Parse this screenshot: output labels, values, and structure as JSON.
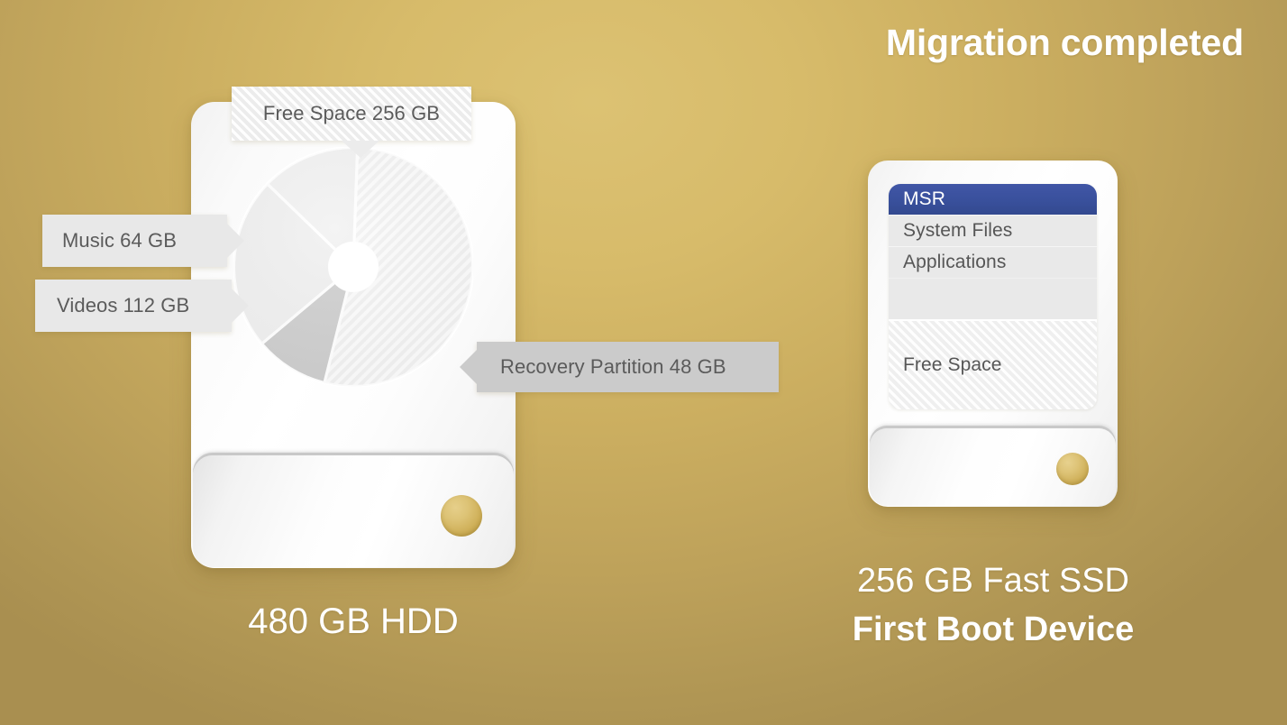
{
  "title": "Migration completed",
  "theme": {
    "background_gold_light": "#DCC273",
    "background_gold_dark": "#A98F50",
    "drive_white": "#FFFFFF",
    "callout_light": "#E8E8E8",
    "callout_dark": "#CBCBCB",
    "msr_blue": "#3B52A0",
    "led_gold": "#DDC376",
    "text_gray": "#5B5B5B",
    "text_white": "#FFFFFF"
  },
  "source_drive": {
    "caption": "480 GB HDD",
    "total_gb": 480,
    "callouts": [
      {
        "label": "Free Space 256 GB",
        "name": "Free Space",
        "size_gb": 256,
        "style": "hatched",
        "tail": "down"
      },
      {
        "label": "Music 64 GB",
        "name": "Music",
        "size_gb": 64,
        "style": "light",
        "tail": "right"
      },
      {
        "label": "Videos 112 GB",
        "name": "Videos",
        "size_gb": 112,
        "style": "light",
        "tail": "right"
      },
      {
        "label": "Recovery Partition 48 GB",
        "name": "Recovery Partition",
        "size_gb": 48,
        "style": "dark",
        "tail": "left"
      }
    ]
  },
  "target_drive": {
    "caption_line1": "256 GB Fast SSD",
    "caption_line2": "First Boot Device",
    "total_gb": 256,
    "partitions": [
      {
        "label": "MSR",
        "style": "msr"
      },
      {
        "label": "System Files",
        "style": "plain"
      },
      {
        "label": "Applications",
        "style": "plain"
      },
      {
        "label": "",
        "style": "empty-gap"
      },
      {
        "label": "Free Space",
        "style": "hatched"
      }
    ]
  },
  "chart_data": {
    "type": "pie",
    "title": "480 GB HDD partition usage",
    "units": "GB",
    "total": 480,
    "hole_ratio": 0.2,
    "start_angle_deg": -88,
    "direction": "clockwise",
    "categories": [
      "Free Space",
      "Recovery Partition",
      "Videos",
      "Music"
    ],
    "values": [
      256,
      48,
      112,
      64
    ],
    "labels": [
      "Free Space 256 GB",
      "Recovery Partition 48 GB",
      "Videos 112 GB",
      "Music 64 GB"
    ],
    "colors": [
      "#EFEFEF",
      "#C6C6C6",
      "#EDEDED",
      "#EFEFEF"
    ],
    "fills": [
      "hatched",
      "solid",
      "solid",
      "solid"
    ],
    "legend": "callout-labels",
    "grid": false
  }
}
